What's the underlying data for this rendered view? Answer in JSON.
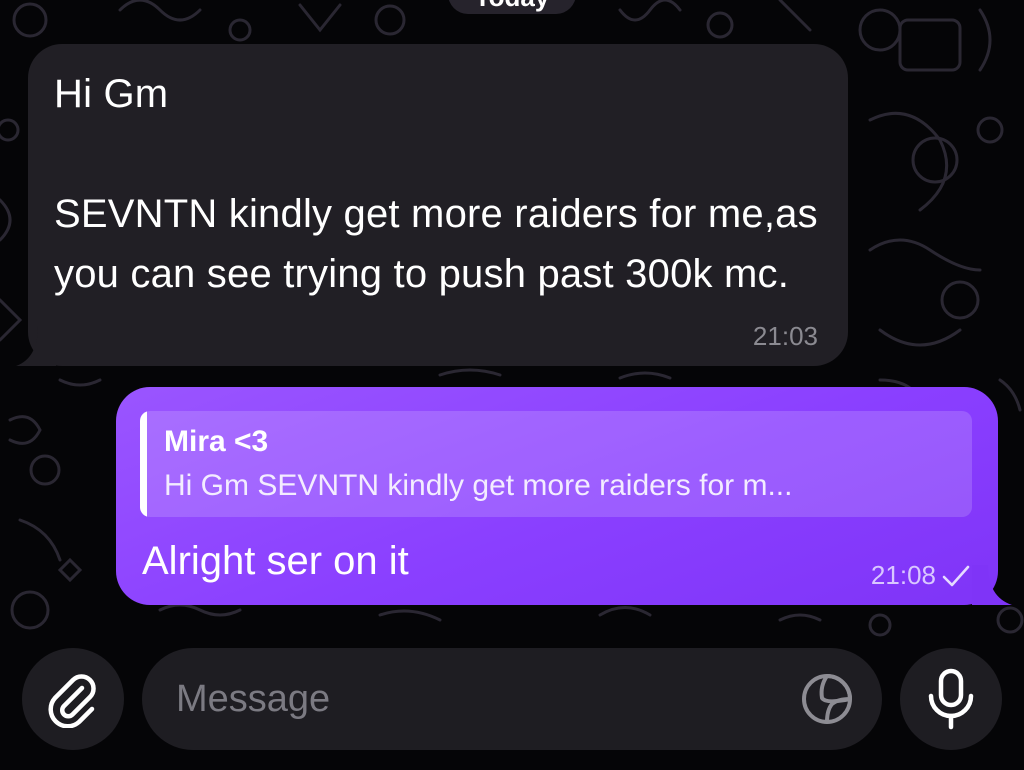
{
  "date_separator": "Today",
  "messages": [
    {
      "direction": "incoming",
      "text": "Hi Gm\n\nSEVNTN kindly get more raiders for me,as you can see trying to push past 300k mc.",
      "time": "21:03"
    },
    {
      "direction": "outgoing",
      "reply": {
        "name": "Mira <3",
        "preview": "Hi Gm SEVNTN kindly get more raiders for m..."
      },
      "text": "Alright ser on it",
      "time": "21:08",
      "status_icon": "single-check-icon"
    }
  ],
  "composer": {
    "placeholder": "Message",
    "attach_icon": "paperclip-icon",
    "sticker_icon": "sticker-icon",
    "mic_icon": "microphone-icon"
  },
  "colors": {
    "background": "#050507",
    "incoming_bubble": "#211f25",
    "outgoing_bubble": "#8a3fff",
    "composer": "#1e1d22"
  }
}
